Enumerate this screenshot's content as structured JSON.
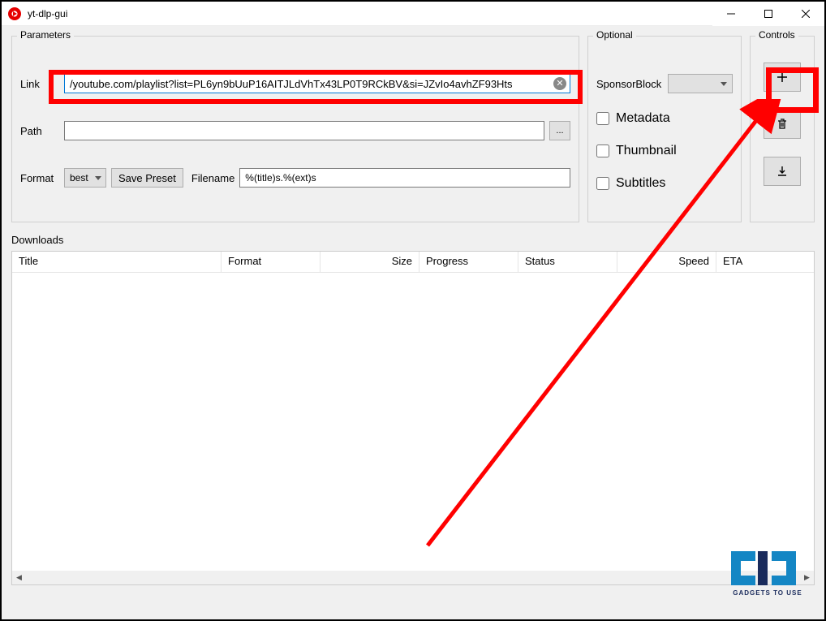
{
  "window": {
    "title": "yt-dlp-gui"
  },
  "parameters": {
    "title": "Parameters",
    "link_label": "Link",
    "link_value": "/youtube.com/playlist?list=PL6yn9bUuP16AITJLdVhTx43LP0T9RCkBV&si=JZvIo4avhZF93Hts",
    "path_label": "Path",
    "path_value": "",
    "browse_label": "...",
    "format_label": "Format",
    "format_value": "best",
    "save_preset_label": "Save Preset",
    "filename_label": "Filename",
    "filename_value": "%(title)s.%(ext)s"
  },
  "optional": {
    "title": "Optional",
    "sponsorblock_label": "SponsorBlock",
    "metadata_label": "Metadata",
    "thumbnail_label": "Thumbnail",
    "subtitles_label": "Subtitles"
  },
  "controls": {
    "title": "Controls"
  },
  "downloads": {
    "title": "Downloads",
    "columns": [
      "Title",
      "Format",
      "Size",
      "Progress",
      "Status",
      "Speed",
      "ETA"
    ]
  },
  "watermark": "GADGETS TO USE"
}
